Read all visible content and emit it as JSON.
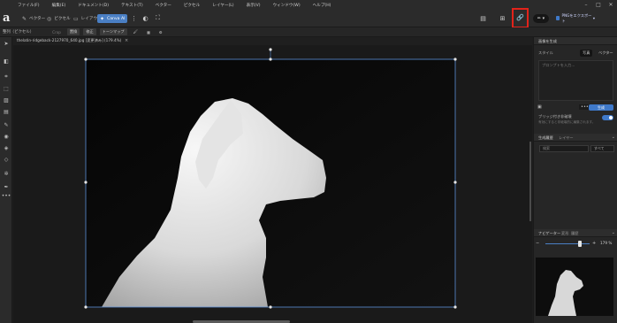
{
  "menu": [
    "ファイル(F)",
    "編集(E)",
    "ドキュメント(D)",
    "テキスト(T)",
    "ベクター",
    "ピクセル",
    "レイヤー(L)",
    "表示(V)",
    "ウィンドウ(W)",
    "ヘルプ(H)"
  ],
  "app": {
    "logo": "a"
  },
  "personas": {
    "vector": "ベクター",
    "pixel": "ピクセル",
    "layout": "レイアウト",
    "canva_ai": "Canva AI"
  },
  "export_label": "PNGをエクスポート",
  "context": {
    "label": "整列（ピクセル）",
    "dim": "Crop",
    "b1": "置換",
    "b2": "修正",
    "b3": "トーンマップ"
  },
  "document": {
    "tab": "thelatin-ridgeback-2127970_640.jpg [変更済み] (179.4%)"
  },
  "panels": {
    "generative": "画像を生成",
    "style_label": "スタイル",
    "seg_photo": "写真",
    "seg_vector": "ベクター",
    "prompt_placeholder": "プロンプトを入力...",
    "generate_btn": "生成",
    "cu_label": "ブリッジ付き非破壊",
    "cu_desc": "有効にすると非破壊的に編集されます。",
    "layers_tab1": "生成履歴",
    "layers_tab2": "レイヤー",
    "search_placeholder": "検索",
    "filter_value": "すべて",
    "nav_tab1": "ナビゲーター",
    "nav_tab2": "変形",
    "nav_tab3": "履歴",
    "zoom": "179 %"
  }
}
